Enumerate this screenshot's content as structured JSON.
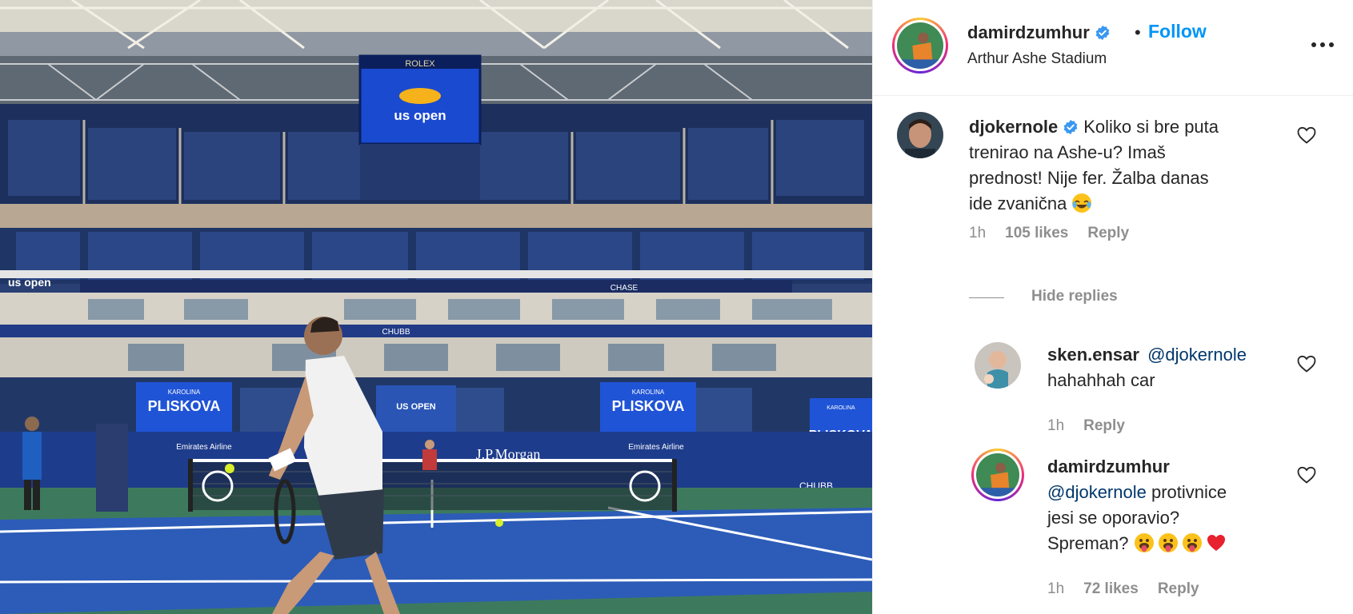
{
  "post": {
    "username": "damirdzumhur",
    "follow_label": "Follow",
    "dot": "•",
    "location": "Arthur Ashe Stadium",
    "photo_signage": {
      "scoreboard_brand": "ROLEX",
      "scoreboard_logo": "us open",
      "player_banner_small": "KAROLINA",
      "player_banner": "PLISKOVA",
      "sponsor_main": "J.P.Morgan",
      "sponsor_emirates": "Emirates Airline",
      "sponsor_chubb": "CHUBB",
      "sponsor_chase": "CHASE",
      "brand_usopen": "us open",
      "brand_usopen_upper": "US OPEN"
    }
  },
  "comments": [
    {
      "username": "djokernole",
      "verified": true,
      "text_lines": [
        "Koliko si bre puta",
        "trenirao na Ashe-u? Imaš",
        "prednost! Nije fer. Žalba danas",
        "ide zvanična"
      ],
      "emoji": "tears-of-joy",
      "time": "1h",
      "likes": "105 likes",
      "reply_label": "Reply"
    }
  ],
  "hide_replies_label": "Hide replies",
  "replies": [
    {
      "username": "sken.ensar",
      "mention": "@djokernole",
      "text": "hahahhah car",
      "time": "1h",
      "reply_label": "Reply"
    },
    {
      "username": "damirdzumhur",
      "mention": "@djokernole",
      "text_lines": [
        "protivnice",
        "jesi se oporavio?",
        "Spreman?"
      ],
      "emojis": [
        "tongue-face",
        "tongue-face",
        "tongue-face",
        "red-heart"
      ],
      "time": "1h",
      "likes": "72 likes",
      "reply_label": "Reply"
    }
  ],
  "colors": {
    "follow": "#0095f6",
    "verified": "#3897f0",
    "muted": "#8e8e8e",
    "mention": "#00376b",
    "court_blue": "#2a5ab8",
    "court_green": "#3f7d62",
    "stands": "#1f3566"
  }
}
